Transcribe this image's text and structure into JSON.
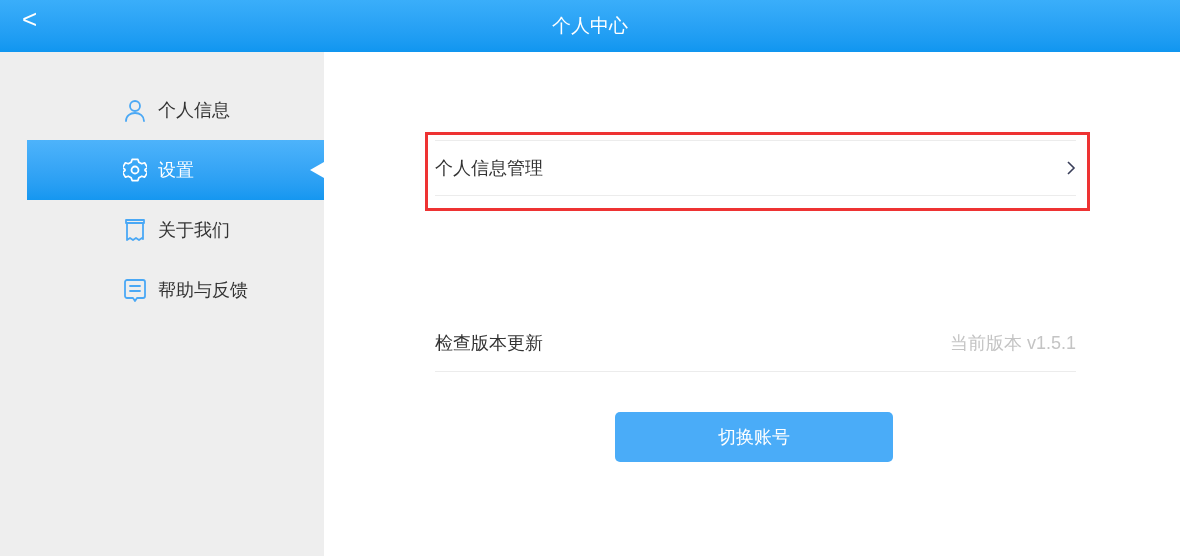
{
  "header": {
    "back_glyph": "<",
    "title": "个人中心"
  },
  "sidebar": {
    "items": [
      {
        "kind": "user",
        "label": "个人信息",
        "selected": false
      },
      {
        "kind": "gear",
        "label": "设置",
        "selected": true
      },
      {
        "kind": "scroll",
        "label": "关于我们",
        "selected": false
      },
      {
        "kind": "message",
        "label": "帮助与反馈",
        "selected": false
      }
    ]
  },
  "settings": [
    {
      "kind": "link",
      "label": "个人信息管理",
      "highlighted": true
    },
    {
      "kind": "info",
      "label": "检查版本更新",
      "value": "当前版本 v1.5.1",
      "highlighted": false
    }
  ],
  "switch_account_button": "切换账号"
}
